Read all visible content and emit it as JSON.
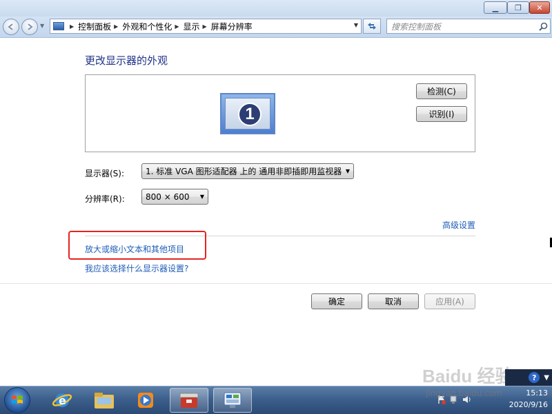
{
  "window": {
    "controls": {
      "minimize": "▁",
      "maximize": "❐",
      "close": "✕"
    }
  },
  "address": {
    "crumbs": [
      "控制面板",
      "外观和个性化",
      "显示",
      "屏幕分辨率"
    ],
    "search_placeholder": "搜索控制面板"
  },
  "main": {
    "heading": "更改显示器的外观",
    "monitor_number": "1",
    "detect_button": "检测(C)",
    "identify_button": "识别(I)",
    "display_label": "显示器(S):",
    "display_value": "1. 标准 VGA 图形适配器 上的 通用非即插即用监视器",
    "resolution_label": "分辨率(R):",
    "resolution_value": "800 × 600",
    "advanced_link": "高级设置",
    "zoom_link": "放大或缩小文本和其他项目",
    "help_link": "我应该选择什么显示器设置?",
    "ok_button": "确定",
    "cancel_button": "取消",
    "apply_button": "应用(A)"
  },
  "watermark": {
    "logo_text": "Baidu 经验",
    "url": "jingyan.baidu.com"
  },
  "taskbar": {
    "clock_time": "15:13",
    "clock_date": "2020/9/16"
  },
  "colors": {
    "link": "#1e5db8",
    "heading": "#1e3287",
    "highlight_box": "#e5231f"
  }
}
